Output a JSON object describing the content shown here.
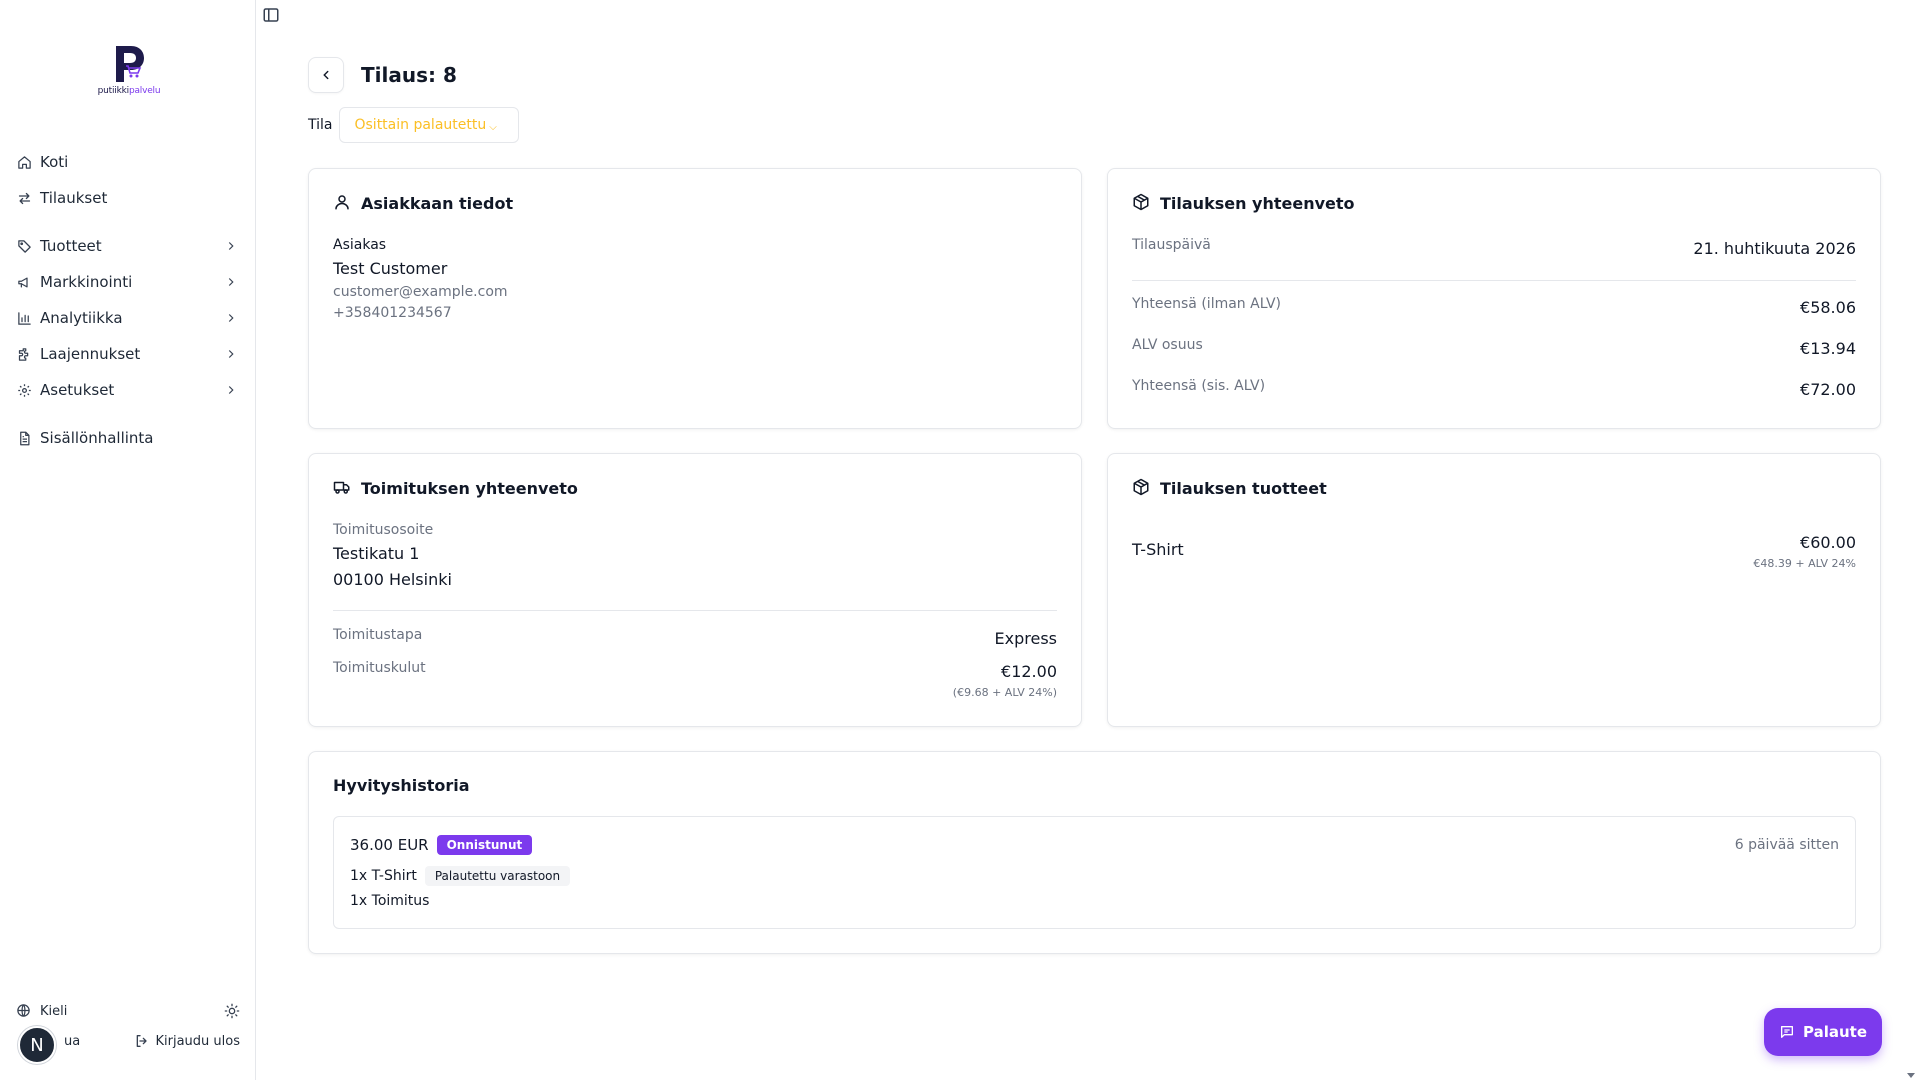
{
  "brand": {
    "name_main": "putiikki",
    "name_accent": "palvelu",
    "accent_color": "#7c3aed",
    "dark_color": "#1e1b4b"
  },
  "sidebar": {
    "items": [
      {
        "label": "Koti",
        "icon": "home-icon",
        "has_children": false
      },
      {
        "label": "Tilaukset",
        "icon": "arrows-swap-icon",
        "has_children": false
      },
      {
        "label": "Tuotteet",
        "icon": "tag-icon",
        "has_children": true
      },
      {
        "label": "Markkinointi",
        "icon": "megaphone-icon",
        "has_children": true
      },
      {
        "label": "Analytiikka",
        "icon": "bar-chart-icon",
        "has_children": true
      },
      {
        "label": "Laajennukset",
        "icon": "puzzle-icon",
        "has_children": true
      },
      {
        "label": "Asetukset",
        "icon": "gear-icon",
        "has_children": true
      },
      {
        "label": "Sisällönhallinta",
        "icon": "document-icon",
        "has_children": false
      }
    ],
    "language_label": "Kieli",
    "help_label": "ua",
    "logout_label": "Kirjaudu ulos",
    "avatar_letter": "N"
  },
  "header": {
    "title": "Tilaus: 8",
    "status_label": "Tila",
    "status_value": "Osittain palautettu",
    "status_color": "#fbbf24"
  },
  "customer": {
    "title": "Asiakkaan tiedot",
    "label": "Asiakas",
    "name": "Test Customer",
    "email": "customer@example.com",
    "phone": "+358401234567"
  },
  "summary": {
    "title": "Tilauksen yhteenveto",
    "date_label": "Tilauspäivä",
    "date_value": "21. huhtikuuta 2026",
    "rows": [
      {
        "label": "Yhteensä (ilman ALV)",
        "value": "€58.06"
      },
      {
        "label": "ALV osuus",
        "value": "€13.94"
      },
      {
        "label": "Yhteensä (sis. ALV)",
        "value": "€72.00"
      }
    ]
  },
  "shipping": {
    "title": "Toimituksen yhteenveto",
    "address_label": "Toimitusosoite",
    "address_line1": "Testikatu 1",
    "address_line2": "00100 Helsinki",
    "method_label": "Toimitustapa",
    "method_value": "Express",
    "cost_label": "Toimituskulut",
    "cost_value": "€12.00",
    "cost_detail": "(€9.68 + ALV 24%)"
  },
  "products": {
    "title": "Tilauksen tuotteet",
    "items": [
      {
        "name": "T-Shirt",
        "price": "€60.00",
        "detail": "€48.39 + ALV 24%"
      }
    ]
  },
  "refunds": {
    "title": "Hyvityshistoria",
    "entries": [
      {
        "amount": "36.00 EUR",
        "status": "Onnistunut",
        "time": "6 päivää sitten",
        "line1": "1x T-Shirt",
        "line1_badge": "Palautettu varastoon",
        "line2": "1x Toimitus"
      }
    ]
  },
  "feedback": {
    "label": "Palaute"
  }
}
